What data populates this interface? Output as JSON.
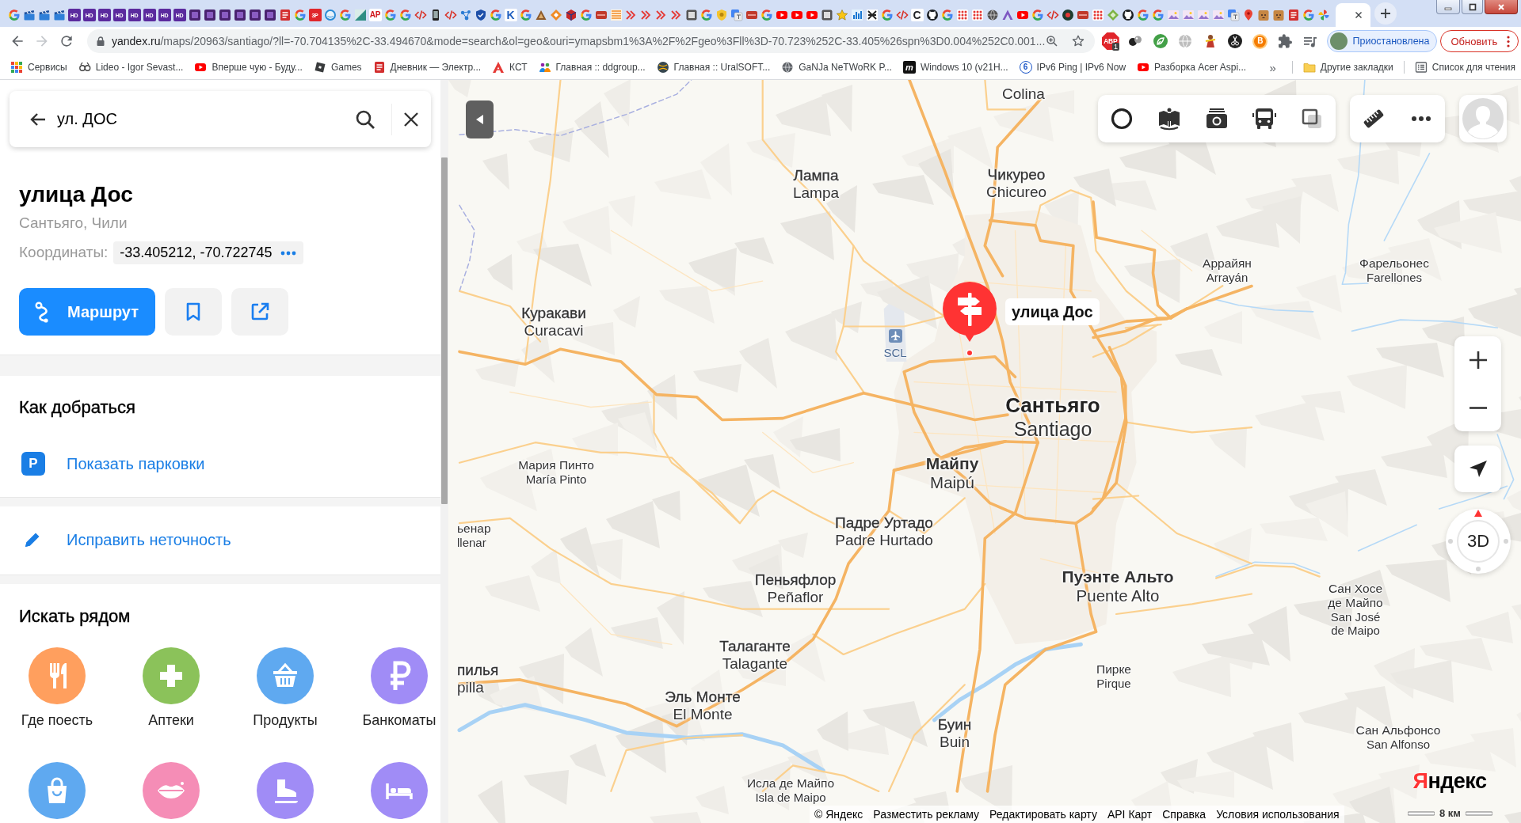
{
  "browser": {
    "tabs": [
      {
        "kind": "google",
        "selected": false
      },
      {
        "kind": "clapper",
        "selected": false
      },
      {
        "kind": "clapper",
        "selected": false
      },
      {
        "kind": "clapper",
        "selected": false
      },
      {
        "kind": "letter-solid",
        "glyph": "HD",
        "color": "#5b2a9e",
        "selected": false
      },
      {
        "kind": "letter-solid",
        "glyph": "HD",
        "color": "#5b2a9e",
        "selected": false
      },
      {
        "kind": "letter-solid",
        "glyph": "HD",
        "color": "#5b2a9e",
        "selected": false
      },
      {
        "kind": "letter-solid",
        "glyph": "HD",
        "color": "#5b2a9e",
        "selected": false
      },
      {
        "kind": "letter-solid",
        "glyph": "HD",
        "color": "#5b2a9e",
        "selected": false
      },
      {
        "kind": "letter-solid",
        "glyph": "HD",
        "color": "#5b2a9e",
        "selected": false
      },
      {
        "kind": "letter-solid",
        "glyph": "HD",
        "color": "#5b2a9e",
        "selected": false
      },
      {
        "kind": "letter-solid",
        "glyph": "HD",
        "color": "#5b2a9e",
        "selected": false
      },
      {
        "kind": "video",
        "selected": false
      },
      {
        "kind": "video",
        "selected": false
      },
      {
        "kind": "video",
        "selected": false
      },
      {
        "kind": "video",
        "selected": false
      },
      {
        "kind": "video",
        "selected": false
      },
      {
        "kind": "video",
        "selected": false
      },
      {
        "kind": "doc",
        "selected": false
      },
      {
        "kind": "google",
        "selected": false
      },
      {
        "kind": "letter-solid",
        "glyph": "3P",
        "color": "#e0262b",
        "selected": false
      },
      {
        "kind": "ring",
        "selected": false
      },
      {
        "kind": "google",
        "selected": false
      },
      {
        "kind": "teal",
        "selected": false
      },
      {
        "kind": "letter-plain",
        "glyph": "AP",
        "color": "#d0141a",
        "selected": false
      },
      {
        "kind": "google",
        "selected": false
      },
      {
        "kind": "google",
        "selected": false
      },
      {
        "kind": "code",
        "selected": false
      },
      {
        "kind": "phone",
        "selected": false
      },
      {
        "kind": "code",
        "selected": false
      },
      {
        "kind": "nodes",
        "selected": false
      },
      {
        "kind": "shield",
        "selected": false
      },
      {
        "kind": "google",
        "selected": false
      },
      {
        "kind": "letter-plain",
        "glyph": "K",
        "color": "#1f5fbf",
        "selected": false
      },
      {
        "kind": "google",
        "selected": false
      },
      {
        "kind": "triangle",
        "selected": false
      },
      {
        "kind": "diamond",
        "selected": false
      },
      {
        "kind": "cube",
        "selected": false
      },
      {
        "kind": "google",
        "selected": false
      },
      {
        "kind": "redbox",
        "selected": false
      },
      {
        "kind": "stripes",
        "selected": false
      },
      {
        "kind": "squiggle",
        "selected": false
      },
      {
        "kind": "squiggle",
        "selected": false
      },
      {
        "kind": "squiggle",
        "selected": false
      },
      {
        "kind": "squiggle",
        "selected": false
      },
      {
        "kind": "tile",
        "selected": false
      },
      {
        "kind": "google",
        "selected": false
      },
      {
        "kind": "badge",
        "selected": false
      },
      {
        "kind": "translate",
        "selected": false
      },
      {
        "kind": "redbox",
        "selected": false
      },
      {
        "kind": "google",
        "selected": false
      },
      {
        "kind": "youtube",
        "selected": false
      },
      {
        "kind": "youtube",
        "selected": false
      },
      {
        "kind": "youtube",
        "selected": false
      },
      {
        "kind": "tile",
        "selected": false
      },
      {
        "kind": "star",
        "selected": false
      },
      {
        "kind": "bars",
        "selected": false
      },
      {
        "kind": "cross",
        "selected": false
      },
      {
        "kind": "google",
        "selected": false
      },
      {
        "kind": "code",
        "selected": false
      },
      {
        "kind": "letter-plain",
        "glyph": "C",
        "color": "#202124",
        "selected": false
      },
      {
        "kind": "github",
        "selected": false
      },
      {
        "kind": "google",
        "selected": false
      },
      {
        "kind": "dots",
        "selected": false
      },
      {
        "kind": "dots",
        "selected": false
      },
      {
        "kind": "globe",
        "selected": false
      },
      {
        "kind": "peak",
        "selected": false
      },
      {
        "kind": "youtube",
        "selected": false
      },
      {
        "kind": "google",
        "selected": false
      },
      {
        "kind": "code",
        "selected": false
      },
      {
        "kind": "disc",
        "selected": false
      },
      {
        "kind": "redbox",
        "selected": false
      },
      {
        "kind": "dots",
        "selected": false
      },
      {
        "kind": "gem",
        "selected": false
      },
      {
        "kind": "github",
        "selected": false
      },
      {
        "kind": "google",
        "selected": false
      },
      {
        "kind": "google",
        "selected": false
      },
      {
        "kind": "picture",
        "selected": false
      },
      {
        "kind": "picture",
        "selected": false
      },
      {
        "kind": "picture",
        "selected": false
      },
      {
        "kind": "picture",
        "selected": false
      },
      {
        "kind": "translate",
        "selected": false
      },
      {
        "kind": "pin",
        "selected": false
      },
      {
        "kind": "pet",
        "selected": false
      },
      {
        "kind": "pet",
        "selected": false
      },
      {
        "kind": "doc",
        "selected": false
      },
      {
        "kind": "google",
        "selected": false
      },
      {
        "kind": "pinwheel",
        "selected": false
      },
      {
        "kind": "blank",
        "selected": true
      }
    ],
    "nav": [
      {
        "kind": "back",
        "disabled": false
      },
      {
        "kind": "forward",
        "disabled": true
      },
      {
        "kind": "reload",
        "disabled": false
      }
    ],
    "address": {
      "host": "yandex.ru",
      "path": "/maps/20963/santiago/?ll=-70.704135%2C-33.494670&mode=search&ol=geo&ouri=ymapsbm1%3A%2F%2Fgeo%3Fll%3D-70.723%252C-33.405%26spn%3D0.004%252C0.001..."
    },
    "extensions": [
      {
        "kind": "adblock",
        "glyph": "ABP",
        "badge": "1"
      },
      {
        "kind": "orbs"
      },
      {
        "kind": "leaf"
      },
      {
        "kind": "globe"
      },
      {
        "kind": "figure"
      },
      {
        "kind": "scissors"
      },
      {
        "kind": "letter",
        "glyph": "B"
      },
      {
        "kind": "puzzle"
      },
      {
        "kind": "playlist"
      }
    ],
    "profile": {
      "label": "Приостановлена"
    },
    "update": {
      "label": "Обновить"
    },
    "bookmarks": [
      {
        "kind": "apps",
        "label": "Сервисы"
      },
      {
        "kind": "loops",
        "label": "Lideo - Igor Sevast..."
      },
      {
        "kind": "youtube",
        "label": "Вперше чую - Буду..."
      },
      {
        "kind": "tilted",
        "label": "Games"
      },
      {
        "kind": "doc",
        "label": "Дневник — Электр..."
      },
      {
        "kind": "peak",
        "label": "КСТ"
      },
      {
        "kind": "people",
        "label": "Главная :: ddgroup..."
      },
      {
        "kind": "ball",
        "label": "Главная :: UralSOFT..."
      },
      {
        "kind": "globe",
        "label": "GaNJa NeTWoRK P..."
      },
      {
        "kind": "letter",
        "glyph": "m",
        "label": "Windows 10 (v21H..."
      },
      {
        "kind": "ring",
        "glyph": "6",
        "label": "IPv6 Ping | IPv6 Now"
      },
      {
        "kind": "youtube",
        "label": "Разборка Acer Aspi..."
      }
    ],
    "more": "»",
    "other": {
      "label": "Другие закладки"
    },
    "reading_list": {
      "label": "Список для чтения"
    }
  },
  "panel": {
    "search": {
      "value": "ул. ДОС"
    },
    "place": {
      "title": "улица Дос",
      "subtitle": "Сантьяго, Чили",
      "coords_label": "Координаты:",
      "coords": "-33.405212, -70.722745"
    },
    "actions": [
      {
        "kind": "route",
        "label": "Маршрут"
      },
      {
        "kind": "bookmark"
      },
      {
        "kind": "share"
      }
    ],
    "directions": {
      "title": "Как добраться",
      "links": [
        {
          "kind": "parking",
          "glyph": "P",
          "label": "Показать парковки"
        }
      ]
    },
    "feedback": {
      "kind": "edit",
      "label": "Исправить неточность"
    },
    "nearby": {
      "title": "Искать рядом",
      "categories": [
        {
          "kind": "food",
          "label": "Где поесть",
          "color": "#ff9f5e"
        },
        {
          "kind": "pharmacy",
          "label": "Аптеки",
          "color": "#8bc25a"
        },
        {
          "kind": "grocery",
          "label": "Продукты",
          "color": "#5fa9f0"
        },
        {
          "kind": "atm",
          "label": "Банкоматы",
          "color": "#a08cf6"
        },
        {
          "kind": "shop",
          "color": "#5fa9f0"
        },
        {
          "kind": "beauty",
          "color": "#f58db6"
        },
        {
          "kind": "skating",
          "color": "#a08cf6"
        },
        {
          "kind": "hotel",
          "color": "#a08cf6"
        }
      ]
    }
  },
  "map": {
    "places": [
      {
        "kind": "town",
        "lines": [
          "Colina"
        ]
      },
      {
        "kind": "town",
        "lines": [
          "Лампа",
          "Lampa"
        ]
      },
      {
        "kind": "town",
        "lines": [
          "Чикурео",
          "Chicureo"
        ]
      },
      {
        "kind": "village",
        "lines": [
          "Аррайян",
          "Arrayán"
        ]
      },
      {
        "kind": "village",
        "lines": [
          "Фарельонес",
          "Farellones"
        ]
      },
      {
        "kind": "town",
        "lines": [
          "Куракави",
          "Curacavi"
        ]
      },
      {
        "kind": "capital",
        "lines": [
          "Сантьяго",
          "Santiago"
        ]
      },
      {
        "kind": "village",
        "lines": [
          "Мария Пинто",
          "María Pinto"
        ]
      },
      {
        "kind": "city",
        "lines": [
          "Майпу",
          "Maipú"
        ]
      },
      {
        "kind": "village",
        "lines": [
          "ьенар",
          "llenar"
        ]
      },
      {
        "kind": "town",
        "lines": [
          "Падре Уртадо",
          "Padre Hurtado"
        ]
      },
      {
        "kind": "town",
        "lines": [
          "Пеньяфлор",
          "Peñaflor"
        ]
      },
      {
        "kind": "city",
        "lines": [
          "Пуэнте Альто",
          "Puente Alto"
        ]
      },
      {
        "kind": "village",
        "lines": [
          "Сан Хосе",
          "де Майпо",
          "San José",
          "de Maipo"
        ]
      },
      {
        "kind": "town",
        "lines": [
          "Талаганте",
          "Talagante"
        ]
      },
      {
        "kind": "village",
        "lines": [
          "Пирке",
          "Pirque"
        ]
      },
      {
        "kind": "town",
        "lines": [
          "пилья",
          "pilla"
        ]
      },
      {
        "kind": "town",
        "lines": [
          "Эль Монте",
          "El Monte"
        ]
      },
      {
        "kind": "town",
        "lines": [
          "Буин",
          "Buin"
        ]
      },
      {
        "kind": "village",
        "lines": [
          "Сан Альфонсо",
          "San Alfonso"
        ]
      },
      {
        "kind": "village",
        "lines": [
          "Исла де Майпо",
          "Isla de Maipo"
        ]
      }
    ],
    "pin": {
      "label": "улица Дос"
    },
    "airport": {
      "code": "SCL"
    },
    "compass": {
      "label": "3D"
    },
    "logo": "Яндекс",
    "attribution": [
      "© Яндекс",
      "Разместить рекламу",
      "Редактировать карту",
      "API Карт",
      "Справка",
      "Условия использования"
    ],
    "scale": "8 км"
  }
}
